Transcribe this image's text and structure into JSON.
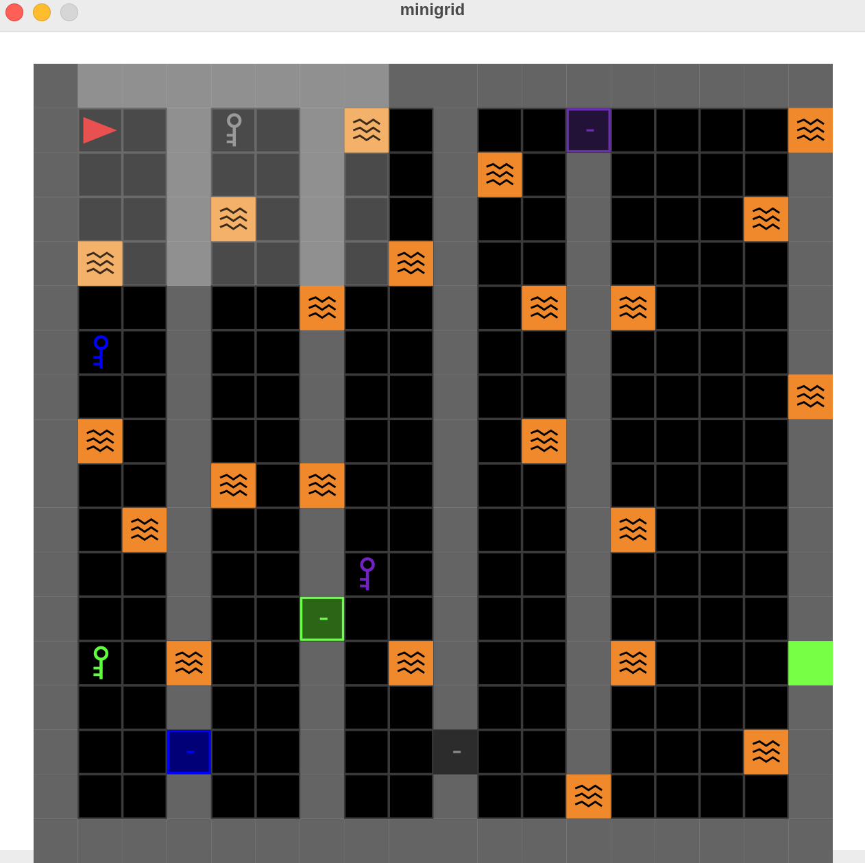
{
  "window": {
    "title": "minigrid"
  },
  "colors": {
    "wall": "#646464",
    "floor": "#000000",
    "grid_line": "#4a4a4a",
    "highlight": "#909090",
    "lava": "#f0892c",
    "lava_wave": "#000000",
    "agent": "#e8514f",
    "goal": "#76ff44"
  },
  "grid": {
    "size": 18,
    "agent": {
      "col": 1,
      "row": 1,
      "direction": "right"
    },
    "visible_region": {
      "col_from": 1,
      "col_to": 7,
      "row_from": 0,
      "row_to": 4
    },
    "walls": [
      {
        "col": 3,
        "row_from": 1,
        "row_to": 12
      },
      {
        "col": 3,
        "row_from": 14,
        "row_to": 14
      },
      {
        "col": 3,
        "row_from": 16,
        "row_to": 16
      },
      {
        "col": 6,
        "row_from": 1,
        "row_to": 11
      },
      {
        "col": 6,
        "row_from": 13,
        "row_to": 16
      },
      {
        "col": 9,
        "row_from": 1,
        "row_to": 14
      },
      {
        "col": 9,
        "row_from": 16,
        "row_to": 16
      },
      {
        "col": 12,
        "row_from": 2,
        "row_to": 15
      }
    ],
    "lava": [
      [
        7,
        1
      ],
      [
        17,
        1
      ],
      [
        10,
        2
      ],
      [
        4,
        3
      ],
      [
        16,
        3
      ],
      [
        1,
        4
      ],
      [
        8,
        4
      ],
      [
        6,
        5
      ],
      [
        11,
        5
      ],
      [
        13,
        5
      ],
      [
        17,
        7
      ],
      [
        1,
        8
      ],
      [
        11,
        8
      ],
      [
        4,
        9
      ],
      [
        6,
        9
      ],
      [
        2,
        10
      ],
      [
        13,
        10
      ],
      [
        3,
        13
      ],
      [
        8,
        13
      ],
      [
        13,
        13
      ],
      [
        16,
        15
      ],
      [
        12,
        16
      ]
    ],
    "keys": [
      {
        "col": 4,
        "row": 1,
        "color": "grey",
        "hex": "#808080"
      },
      {
        "col": 1,
        "row": 6,
        "color": "blue",
        "hex": "#0000ff"
      },
      {
        "col": 7,
        "row": 11,
        "color": "purple",
        "hex": "#7023c0"
      },
      {
        "col": 1,
        "row": 13,
        "color": "green",
        "hex": "#5eff3b"
      }
    ],
    "doors": [
      {
        "col": 12,
        "row": 1,
        "color": "purple",
        "state": "locked",
        "fill": "#231238",
        "border": "#6a2db3"
      },
      {
        "col": 6,
        "row": 12,
        "color": "green",
        "state": "locked",
        "fill": "#2b6616",
        "border": "#6bff4a"
      },
      {
        "col": 3,
        "row": 15,
        "color": "blue",
        "state": "locked",
        "fill": "#010074",
        "border": "#0000ff"
      },
      {
        "col": 9,
        "row": 15,
        "color": "grey",
        "state": "locked",
        "fill": "#2c2c2c",
        "border": "#2c2c2c"
      }
    ],
    "goal": {
      "col": 17,
      "row": 13
    }
  }
}
